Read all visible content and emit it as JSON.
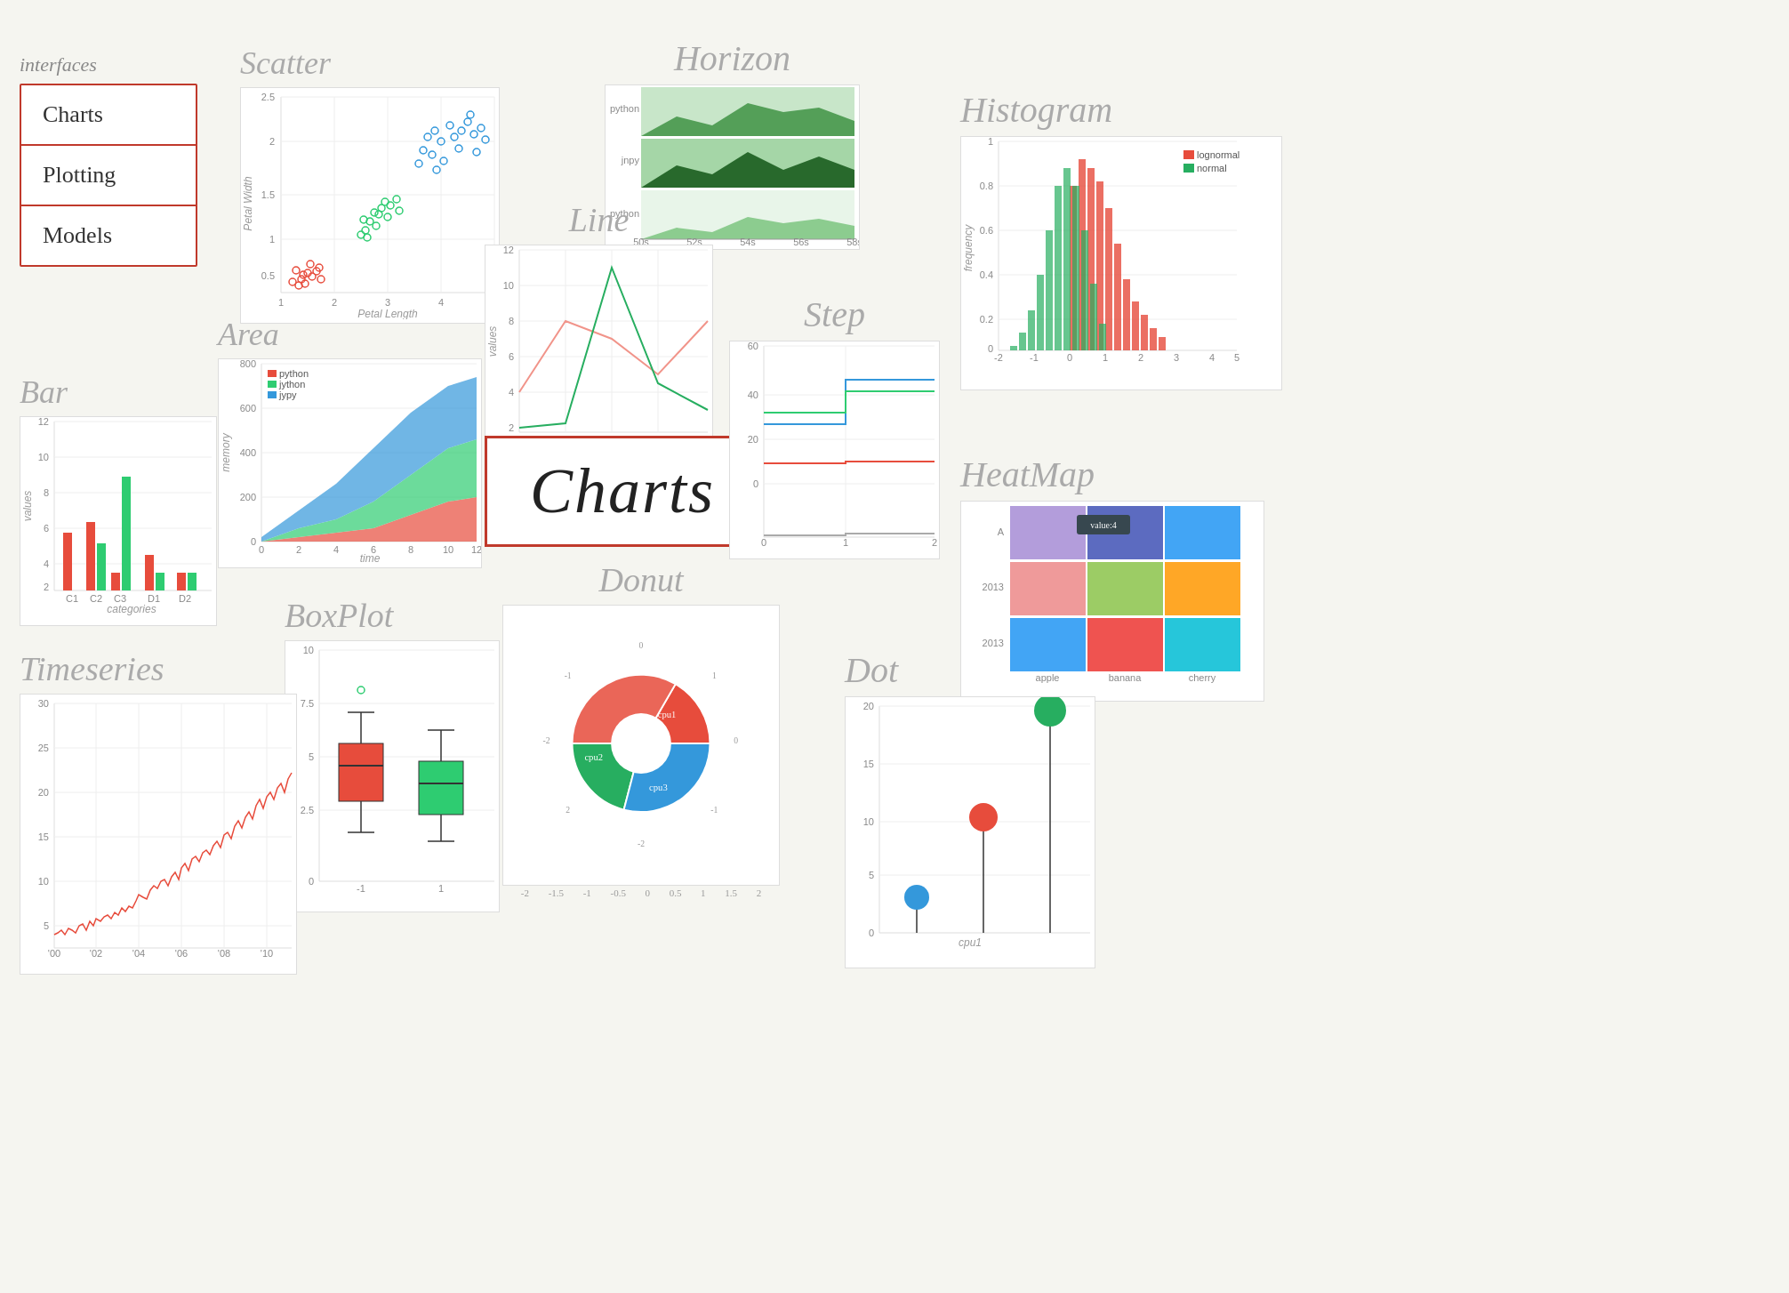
{
  "sidebar": {
    "label": "interfaces",
    "items": [
      {
        "label": "Charts"
      },
      {
        "label": "Plotting"
      },
      {
        "label": "Models"
      }
    ]
  },
  "charts": {
    "scatter": {
      "title": "Scatter"
    },
    "area": {
      "title": "Area"
    },
    "bar": {
      "title": "Bar"
    },
    "horizon": {
      "title": "Horizon"
    },
    "line": {
      "title": "Line"
    },
    "central": {
      "label": "Charts"
    },
    "step": {
      "title": "Step"
    },
    "histogram": {
      "title": "Histogram"
    },
    "boxplot": {
      "title": "BoxPlot"
    },
    "donut": {
      "title": "Donut"
    },
    "heatmap": {
      "title": "HeatMap"
    },
    "timeseries": {
      "title": "Timeseries"
    },
    "dot": {
      "title": "Dot"
    }
  }
}
